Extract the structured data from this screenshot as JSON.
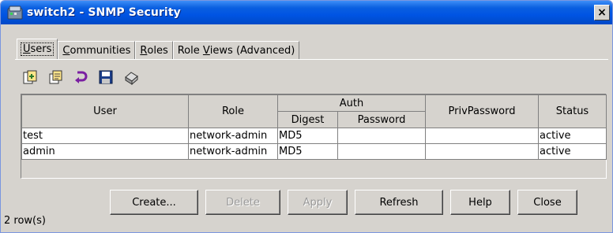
{
  "window": {
    "title": "switch2 - SNMP Security",
    "close_label": "×"
  },
  "tabs": [
    {
      "label_u": "U",
      "label_rest": "sers",
      "active": true
    },
    {
      "label_u": "C",
      "label_rest": "ommunities",
      "active": false
    },
    {
      "label_u": "R",
      "label_rest": "oles",
      "active": false
    },
    {
      "label_pre": "Role ",
      "label_u": "V",
      "label_rest": "iews (Advanced)",
      "active": false
    }
  ],
  "toolbar": {
    "icons": [
      "create-row-icon",
      "duplicate-row-icon",
      "undo-icon",
      "save-icon",
      "print-icon"
    ]
  },
  "table": {
    "headers": {
      "user": "User",
      "role": "Role",
      "auth": "Auth",
      "digest": "Digest",
      "password": "Password",
      "privpassword": "PrivPassword",
      "status": "Status"
    },
    "rows": [
      {
        "user": "test",
        "role": "network-admin",
        "digest": "MD5",
        "password": "",
        "privpassword": "",
        "status": "active"
      },
      {
        "user": "admin",
        "role": "network-admin",
        "digest": "MD5",
        "password": "",
        "privpassword": "",
        "status": "active"
      }
    ]
  },
  "buttons": {
    "create": "Create...",
    "delete": "Delete",
    "apply": "Apply",
    "refresh": "Refresh",
    "help": "Help",
    "close": "Close"
  },
  "status": {
    "row_count": "2 row(s)"
  }
}
